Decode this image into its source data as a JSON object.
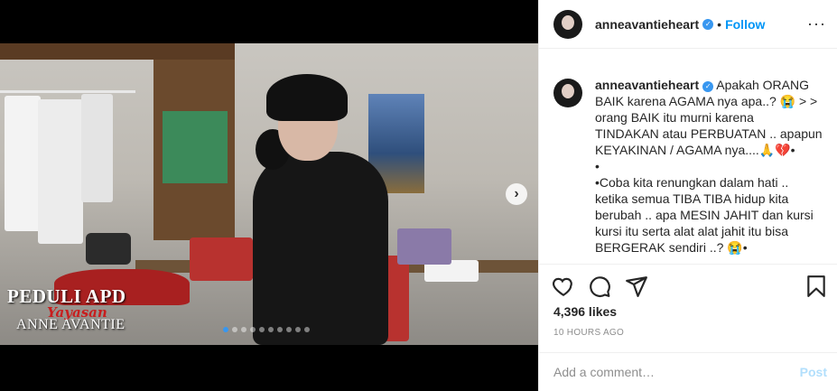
{
  "post": {
    "username": "anneavantieheart",
    "follow_label": "Follow",
    "separator": "•",
    "more_label": "···",
    "verified_glyph": "✓",
    "caption_lines": [
      "Apakah ORANG",
      "BAIK karena AGAMA nya apa..? 😭 > >",
      "orang BAIK itu murni karena",
      "TINDAKAN atau PERBUATAN .. apapun",
      "KEYAKINAN / AGAMA nya....🙏💔•",
      "•",
      "•Coba kita renungkan dalam hati ..",
      "ketika semua TIBA TIBA hidup kita",
      "berubah .. apa MESIN JAHIT dan kursi",
      "kursi itu serta alat alat jahit itu bisa",
      "BERGERAK sendiri ..? 😭•"
    ],
    "likes": "4,396 likes",
    "timestamp": "10 HOURS AGO",
    "comment_placeholder": "Add a comment…",
    "post_label": "Post"
  },
  "media": {
    "overlay_title": "PEDULI APD",
    "overlay_script": "Yayasan",
    "overlay_name": "ANNE AVANTIE",
    "next_arrow": "›",
    "carousel_count": 10,
    "carousel_active": 1
  },
  "icons": [
    "heart-icon",
    "comment-icon",
    "share-icon",
    "bookmark-icon",
    "verified-icon",
    "more-icon",
    "chevron-right-icon"
  ],
  "colors": {
    "accent": "#3897f0",
    "follow": "#0095f6",
    "post_disabled": "#b2dffc",
    "text": "#262626",
    "muted": "#8e8e8e"
  }
}
